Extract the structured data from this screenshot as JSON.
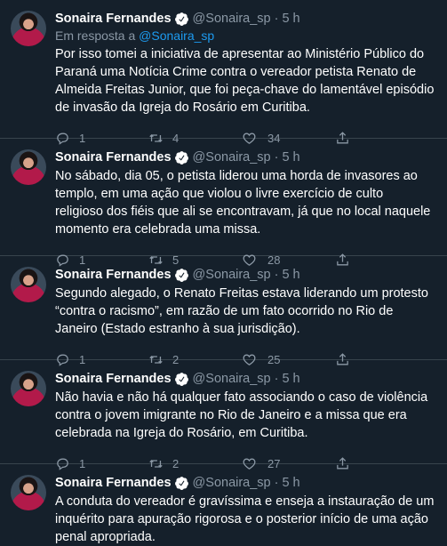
{
  "author": {
    "name": "Sonaira Fernandes",
    "handle": "@Sonaira_sp",
    "time": "5 h",
    "dot": "·"
  },
  "colors": {
    "background": "#15202b",
    "link": "#1d9bf0",
    "muted": "#8b98a5",
    "divider": "#38444d"
  },
  "icons": {
    "reply": "reply-icon",
    "retweet": "retweet-icon",
    "like": "like-icon",
    "share": "share-icon",
    "verified": "verified-badge-icon"
  },
  "tweets": [
    {
      "reply_prefix": "Em resposta a ",
      "reply_mention": "@Sonaira_sp",
      "text": "Por isso tomei a iniciativa de apresentar ao Ministério Público do Paraná uma Notícia Crime contra o vereador petista Renato de Almeida Freitas Junior, que foi peça-chave do lamentável episódio de invasão da Igreja do Rosário em Curitiba.",
      "replies": "1",
      "retweets": "4",
      "likes": "34"
    },
    {
      "text": "No sábado, dia 05, o petista liderou uma horda de invasores ao templo, em uma ação que violou o livre exercício de culto religioso dos fiéis que ali se encontravam, já que no local naquele momento era celebrada uma missa.",
      "replies": "1",
      "retweets": "5",
      "likes": "28"
    },
    {
      "text": "Segundo alegado, o Renato Freitas estava liderando um protesto “contra o racismo”, em razão de um fato ocorrido no Rio de Janeiro (Estado estranho à sua jurisdição).",
      "replies": "1",
      "retweets": "2",
      "likes": "25"
    },
    {
      "text": "Não havia e não há qualquer fato associando o caso de violência contra o jovem imigrante no Rio de Janeiro e a missa que era celebrada na Igreja do Rosário, em Curitiba.",
      "replies": "1",
      "retweets": "2",
      "likes": "27"
    },
    {
      "text": "A conduta do vereador é gravíssima e enseja a instauração de um inquérito para apuração rigorosa e o posterior início de uma ação penal apropriada."
    }
  ]
}
